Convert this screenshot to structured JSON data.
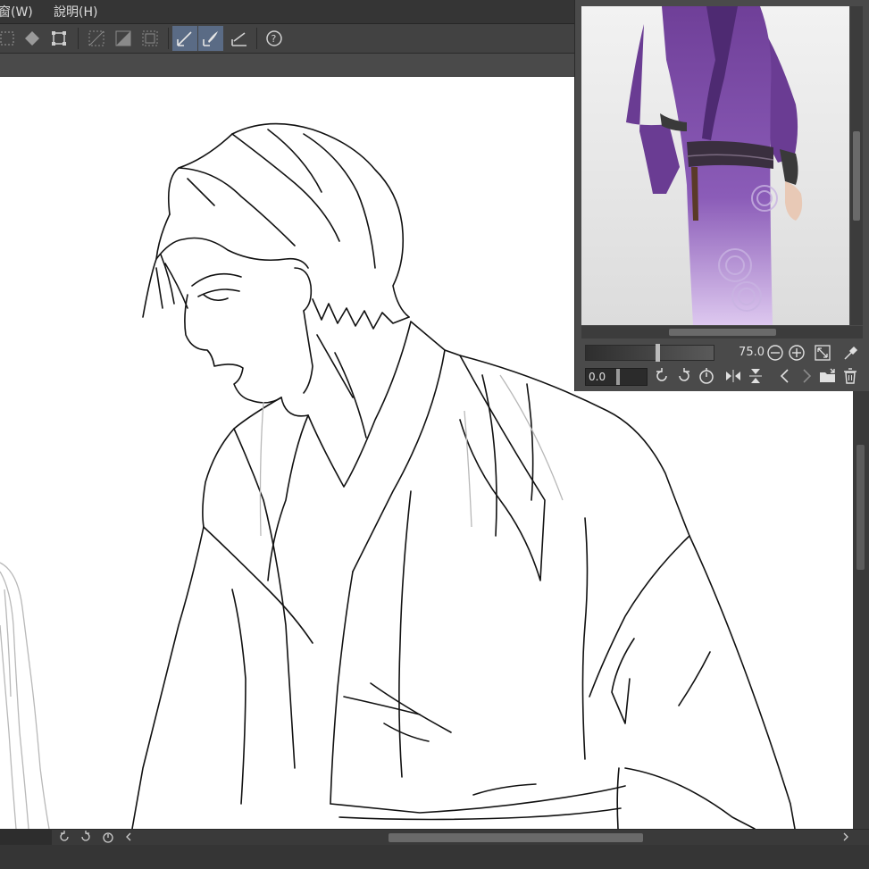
{
  "menu": {
    "window_label": "窗(W)",
    "help_label": "說明(H)"
  },
  "navigator": {
    "zoom_value": "75.0",
    "rotation_value": "0.0"
  },
  "colors": {
    "panel": "#4a4a4a",
    "active_tool": "#5a6b85",
    "kimono": "#7b4ea3"
  },
  "icons": {
    "toolbar": [
      "selection-icon",
      "fill-icon",
      "transform-icon",
      "ruler-icon",
      "snap-icon",
      "grid-icon",
      "pen-snap-icon",
      "brush-snap-icon",
      "ruler-snap-icon",
      "help-icon"
    ],
    "navigator": [
      "zoom-out-icon",
      "zoom-in-icon",
      "fit-icon",
      "eyedropper-icon",
      "rotate-left-icon",
      "rotate-right-icon",
      "reset-rotation-icon",
      "flip-horizontal-icon",
      "flip-vertical-icon",
      "previous-icon",
      "next-icon",
      "open-folder-icon",
      "delete-icon"
    ]
  }
}
